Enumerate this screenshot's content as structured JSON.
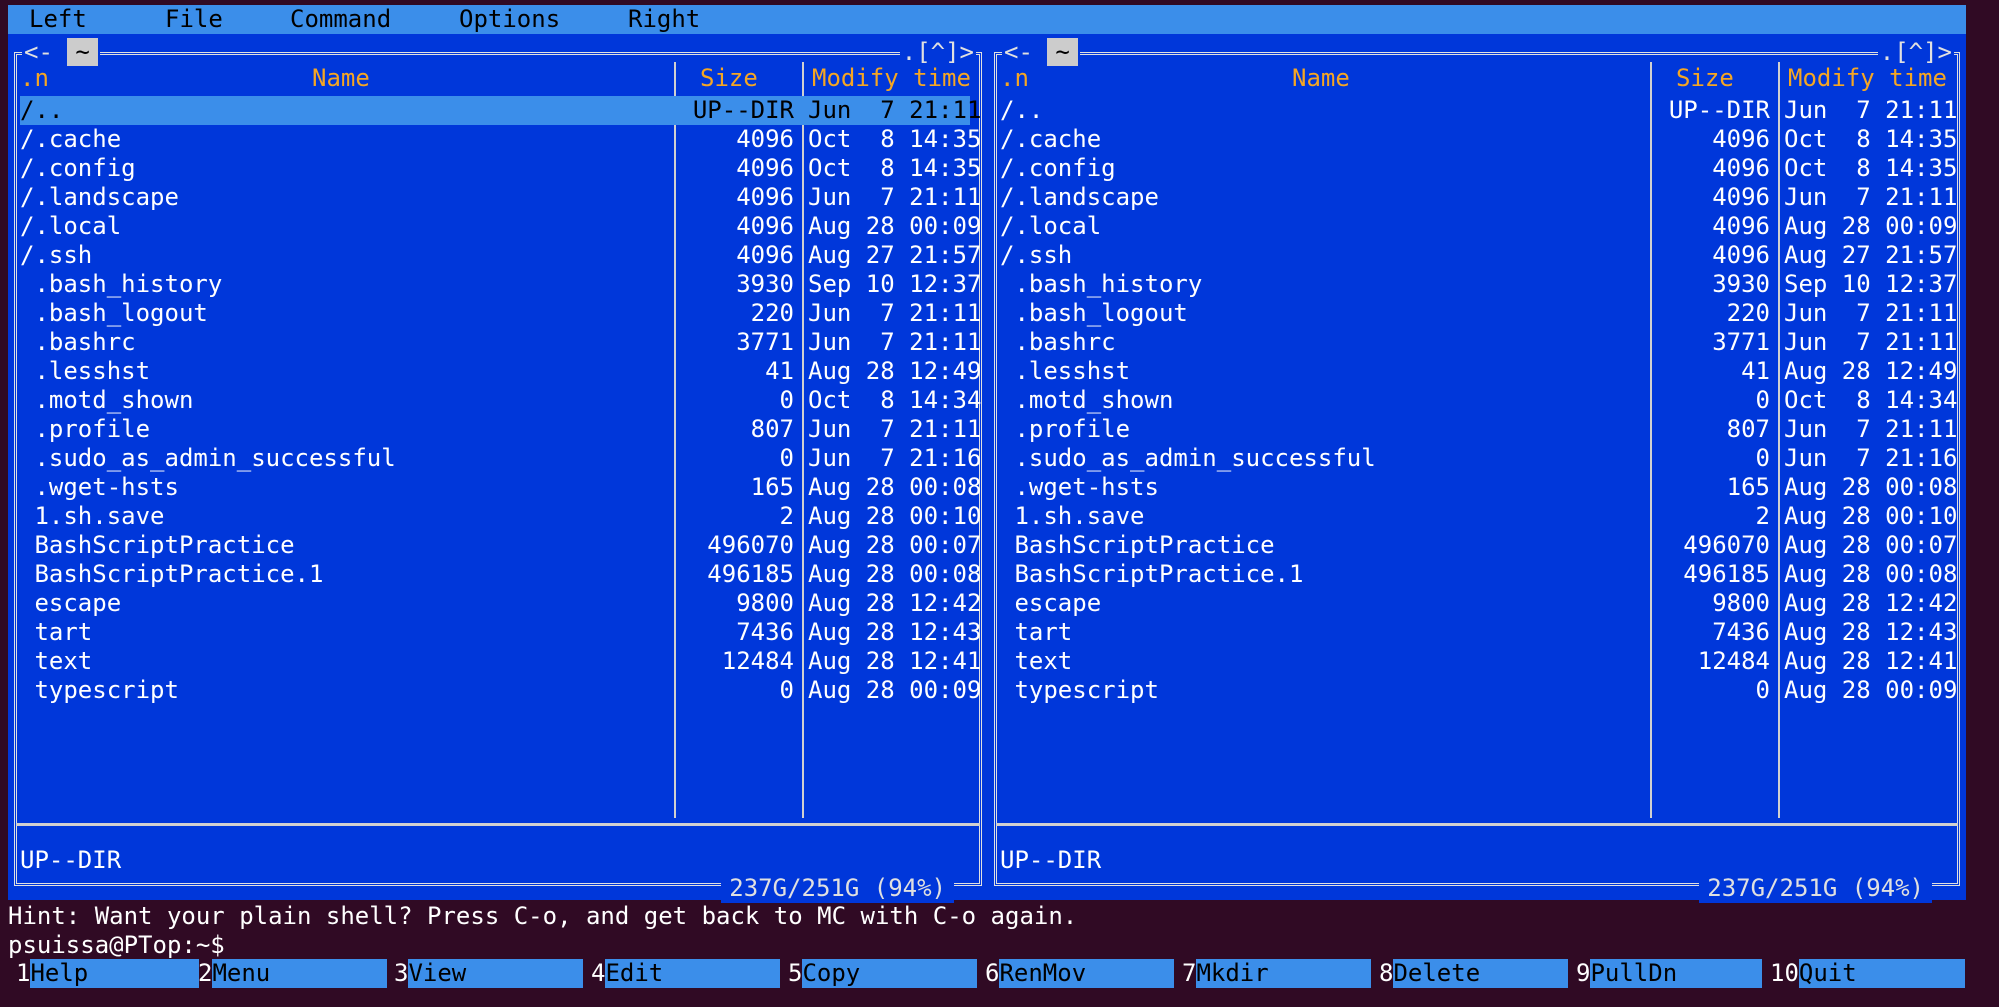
{
  "menu": [
    "Left",
    "File",
    "Command",
    "Options",
    "Right"
  ],
  "panels": [
    {
      "id": "left",
      "title_prefix": "<-",
      "cwd": "~",
      "controls": ".[^]>",
      "columns": [
        ".n",
        "Name",
        "Size",
        "Modify time"
      ],
      "rows": [
        {
          "name": "/..",
          "size": "UP--DIR",
          "date": "Jun  7 21:11",
          "selected": true
        },
        {
          "name": "/.cache",
          "size": "4096",
          "date": "Oct  8 14:35"
        },
        {
          "name": "/.config",
          "size": "4096",
          "date": "Oct  8 14:35"
        },
        {
          "name": "/.landscape",
          "size": "4096",
          "date": "Jun  7 21:11"
        },
        {
          "name": "/.local",
          "size": "4096",
          "date": "Aug 28 00:09"
        },
        {
          "name": "/.ssh",
          "size": "4096",
          "date": "Aug 27 21:57"
        },
        {
          "name": " .bash_history",
          "size": "3930",
          "date": "Sep 10 12:37"
        },
        {
          "name": " .bash_logout",
          "size": "220",
          "date": "Jun  7 21:11"
        },
        {
          "name": " .bashrc",
          "size": "3771",
          "date": "Jun  7 21:11"
        },
        {
          "name": " .lesshst",
          "size": "41",
          "date": "Aug 28 12:49"
        },
        {
          "name": " .motd_shown",
          "size": "0",
          "date": "Oct  8 14:34"
        },
        {
          "name": " .profile",
          "size": "807",
          "date": "Jun  7 21:11"
        },
        {
          "name": " .sudo_as_admin_successful",
          "size": "0",
          "date": "Jun  7 21:16"
        },
        {
          "name": " .wget-hsts",
          "size": "165",
          "date": "Aug 28 00:08"
        },
        {
          "name": " 1.sh.save",
          "size": "2",
          "date": "Aug 28 00:10"
        },
        {
          "name": " BashScriptPractice",
          "size": "496070",
          "date": "Aug 28 00:07"
        },
        {
          "name": " BashScriptPractice.1",
          "size": "496185",
          "date": "Aug 28 00:08"
        },
        {
          "name": " escape",
          "size": "9800",
          "date": "Aug 28 12:42"
        },
        {
          "name": " tart",
          "size": "7436",
          "date": "Aug 28 12:43"
        },
        {
          "name": " text",
          "size": "12484",
          "date": "Aug 28 12:41"
        },
        {
          "name": " typescript",
          "size": "0",
          "date": "Aug 28 00:09"
        }
      ],
      "mini_status": "UP--DIR",
      "free_space": "237G/251G (94%)"
    },
    {
      "id": "right",
      "title_prefix": "<-",
      "cwd": "~",
      "controls": ".[^]>",
      "columns": [
        ".n",
        "Name",
        "Size",
        "Modify time"
      ],
      "rows": [
        {
          "name": "/..",
          "size": "UP--DIR",
          "date": "Jun  7 21:11"
        },
        {
          "name": "/.cache",
          "size": "4096",
          "date": "Oct  8 14:35"
        },
        {
          "name": "/.config",
          "size": "4096",
          "date": "Oct  8 14:35"
        },
        {
          "name": "/.landscape",
          "size": "4096",
          "date": "Jun  7 21:11"
        },
        {
          "name": "/.local",
          "size": "4096",
          "date": "Aug 28 00:09"
        },
        {
          "name": "/.ssh",
          "size": "4096",
          "date": "Aug 27 21:57"
        },
        {
          "name": " .bash_history",
          "size": "3930",
          "date": "Sep 10 12:37"
        },
        {
          "name": " .bash_logout",
          "size": "220",
          "date": "Jun  7 21:11"
        },
        {
          "name": " .bashrc",
          "size": "3771",
          "date": "Jun  7 21:11"
        },
        {
          "name": " .lesshst",
          "size": "41",
          "date": "Aug 28 12:49"
        },
        {
          "name": " .motd_shown",
          "size": "0",
          "date": "Oct  8 14:34"
        },
        {
          "name": " .profile",
          "size": "807",
          "date": "Jun  7 21:11"
        },
        {
          "name": " .sudo_as_admin_successful",
          "size": "0",
          "date": "Jun  7 21:16"
        },
        {
          "name": " .wget-hsts",
          "size": "165",
          "date": "Aug 28 00:08"
        },
        {
          "name": " 1.sh.save",
          "size": "2",
          "date": "Aug 28 00:10"
        },
        {
          "name": " BashScriptPractice",
          "size": "496070",
          "date": "Aug 28 00:07"
        },
        {
          "name": " BashScriptPractice.1",
          "size": "496185",
          "date": "Aug 28 00:08"
        },
        {
          "name": " escape",
          "size": "9800",
          "date": "Aug 28 12:42"
        },
        {
          "name": " tart",
          "size": "7436",
          "date": "Aug 28 12:43"
        },
        {
          "name": " text",
          "size": "12484",
          "date": "Aug 28 12:41"
        },
        {
          "name": " typescript",
          "size": "0",
          "date": "Aug 28 00:09"
        }
      ],
      "mini_status": "UP--DIR",
      "free_space": "237G/251G (94%)"
    }
  ],
  "hint": "Hint: Want your plain shell? Press C-o, and get back to MC with C-o again.",
  "prompt": "psuissa@PTop:~$",
  "fkeys": [
    {
      "num": "1",
      "label": "Help"
    },
    {
      "num": "2",
      "label": "Menu"
    },
    {
      "num": "3",
      "label": "View"
    },
    {
      "num": "4",
      "label": "Edit"
    },
    {
      "num": "5",
      "label": "Copy"
    },
    {
      "num": "6",
      "label": "RenMov"
    },
    {
      "num": "7",
      "label": "Mkdir"
    },
    {
      "num": "8",
      "label": "Delete"
    },
    {
      "num": "9",
      "label": "PullDn"
    },
    {
      "num": "10",
      "label": "Quit"
    }
  ],
  "colors": {
    "terminal_bg": "#300a24",
    "panel_bg": "#0037da",
    "highlight": "#3b8eea",
    "header": "#f5a623"
  }
}
